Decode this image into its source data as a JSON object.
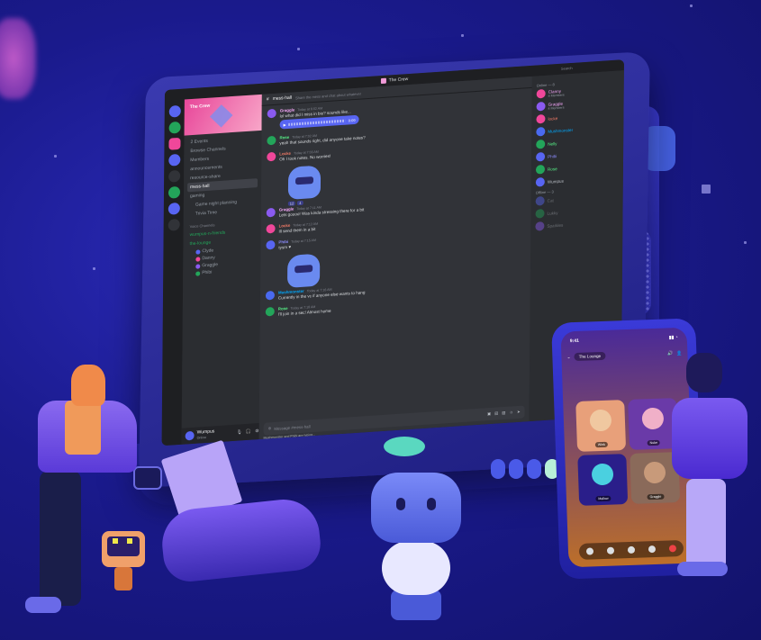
{
  "window": {
    "title": "The Crew"
  },
  "server": {
    "name": "The Crew"
  },
  "sidebar": {
    "top_items": [
      "2 Events",
      "Browse Channels",
      "Members"
    ],
    "channels": [
      {
        "name": "announcements",
        "active": false,
        "sub": false
      },
      {
        "name": "resource-share",
        "active": false,
        "sub": false
      },
      {
        "name": "mess-hall",
        "active": true,
        "sub": false
      },
      {
        "name": "gaming",
        "active": false,
        "sub": false
      },
      {
        "name": "Game night planning",
        "active": false,
        "sub": true
      },
      {
        "name": "Trivia Time",
        "active": false,
        "sub": true
      }
    ],
    "voice_header": "Voice Channels",
    "voice_channels": [
      "wumpus-n-friends",
      "the-lounge"
    ],
    "voice_users": [
      "Clyde",
      "Danny",
      "Graggle",
      "Phibi"
    ]
  },
  "user": {
    "name": "Wumpus",
    "status": "Online"
  },
  "chat": {
    "channel": "mess-hall",
    "topic": "Share the mess and chat about whatever",
    "messages": [
      {
        "author": "Graggle",
        "time": "Today at 6:02 AM",
        "text": "lol what did I miss in bio? sounds like...",
        "color": "#f3a6f7",
        "avatar": "#8a5af0",
        "voice": "0:09"
      },
      {
        "author": "Rose",
        "time": "Today at 7:02 AM",
        "text": "yeah that sounds right, did anyone take notes?",
        "color": "#57f287",
        "avatar": "#23a55a"
      },
      {
        "author": "Locke",
        "time": "Today at 7:03 AM",
        "text": "Oh I took notes. No worries!",
        "color": "#f47b67",
        "avatar": "#f0479a",
        "sticker": true,
        "reactions": [
          "12",
          "4"
        ]
      },
      {
        "author": "Graggle",
        "time": "Today at 7:11 AM",
        "text": "Lets goooo! Was kinda stressing there for a bit",
        "color": "#f3a6f7",
        "avatar": "#8a5af0"
      },
      {
        "author": "Locke",
        "time": "Today at 7:12 AM",
        "text": "Ill send them in a bit",
        "color": "#f47b67",
        "avatar": "#f0479a"
      },
      {
        "author": "Phibi",
        "time": "Today at 7:15 AM",
        "text": "tysm ♥",
        "color": "#8a8af8",
        "avatar": "#5865f2",
        "sticker": true
      },
      {
        "author": "Mushmonster",
        "time": "Today at 7:16 AM",
        "text": "Currently in the vc if anyone else wants to hang",
        "color": "#00a8fc",
        "avatar": "#4a6af0"
      },
      {
        "author": "Rose",
        "time": "Today at 7:18 AM",
        "text": "I'll join in a sec! Almost home",
        "color": "#57f287",
        "avatar": "#23a55a"
      }
    ],
    "composer_placeholder": "Message #mess-hall",
    "typing": "Mushmonster and Phibi are typing..."
  },
  "members": {
    "search_placeholder": "Search",
    "online_header": "Online — 8",
    "online": [
      {
        "name": "Clanny",
        "sub": "4 Members",
        "color": "#f3a6f7",
        "avatar": "#f0479a"
      },
      {
        "name": "Graggle",
        "sub": "4 Members",
        "color": "#f3a6f7",
        "avatar": "#8a5af0"
      },
      {
        "name": "locke",
        "sub": "",
        "color": "#f47b67",
        "avatar": "#f0479a"
      },
      {
        "name": "Mushmonster",
        "sub": "",
        "color": "#00a8fc",
        "avatar": "#4a6af0"
      },
      {
        "name": "Nelly",
        "sub": "",
        "color": "#57f287",
        "avatar": "#23a55a"
      },
      {
        "name": "Phibi",
        "sub": "",
        "color": "#8a8af8",
        "avatar": "#5865f2"
      },
      {
        "name": "Rose",
        "sub": "",
        "color": "#57f287",
        "avatar": "#23a55a"
      },
      {
        "name": "Wumpus",
        "sub": "",
        "color": "#b5bac1",
        "avatar": "#5865f2"
      }
    ],
    "offline_header": "Offline — 3",
    "offline": [
      {
        "name": "Cat",
        "avatar": "#5865f2"
      },
      {
        "name": "Lukky",
        "avatar": "#23a55a"
      },
      {
        "name": "Sparkles",
        "avatar": "#8a5af0"
      }
    ]
  },
  "phone": {
    "time": "9:41",
    "channel": "The Lounge",
    "tiles": [
      {
        "name": "Wink",
        "face": "#f0c8a0",
        "bg": "#e8a07a"
      },
      {
        "name": "Nuke",
        "face": "#f0b0c8",
        "bg": "#6a3aa8"
      },
      {
        "name": "Mallow",
        "face": "#4ad0e0",
        "bg": "#2a1e8a"
      },
      {
        "name": "Graggle",
        "face": "#c89a7a",
        "bg": "#8a6a5a"
      }
    ]
  },
  "colors": {
    "blurple": "#5865f2",
    "background": "#1a1a8c",
    "chat_bg": "#313338"
  }
}
